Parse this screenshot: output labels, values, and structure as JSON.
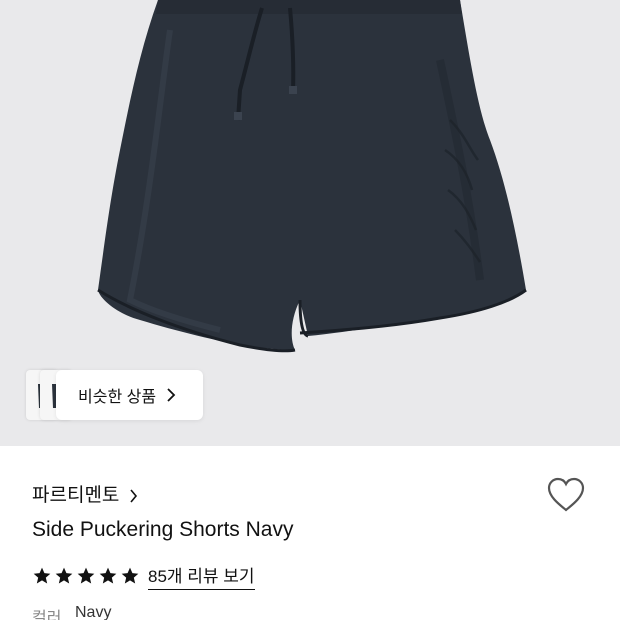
{
  "hero": {
    "image_alt": "navy shorts product photo"
  },
  "similar": {
    "label": "비슷한 상품"
  },
  "product": {
    "brand": "파르티멘토",
    "title": "Side Puckering Shorts Navy",
    "rating": 5,
    "review_link": "85개 리뷰 보기",
    "color_label": "컬러",
    "color_value": "Navy"
  },
  "colors": {
    "shorts": "#2b323c",
    "background": "#e9e9eb",
    "text": "#111111",
    "muted": "#888888"
  }
}
